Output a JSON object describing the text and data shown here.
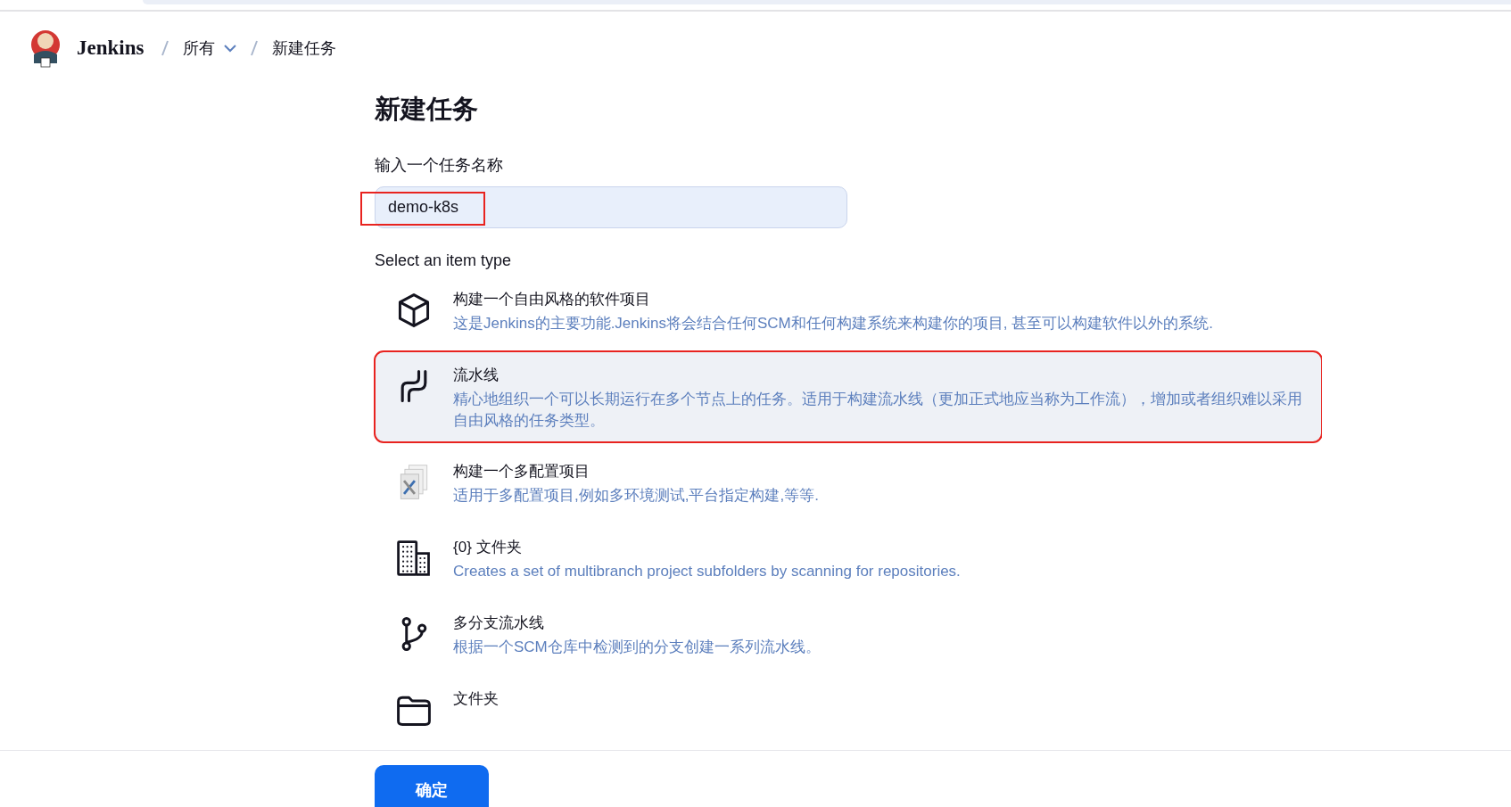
{
  "header": {
    "brand": "Jenkins",
    "breadcrumbs": [
      {
        "label": "所有",
        "dropdown": true
      },
      {
        "label": "新建任务",
        "dropdown": false
      }
    ]
  },
  "title": "新建任务",
  "name_field": {
    "label": "输入一个任务名称",
    "value": "demo-k8s",
    "annotated": true
  },
  "item_type_label": "Select an item type",
  "item_types": [
    {
      "kind": "freestyle",
      "title": "构建一个自由风格的软件项目",
      "description": "这是Jenkins的主要功能.Jenkins将会结合任何SCM和任何构建系统来构建你的项目, 甚至可以构建软件以外的系统.",
      "selected": false,
      "annotated": false
    },
    {
      "kind": "pipeline",
      "title": "流水线",
      "description": "精心地组织一个可以长期运行在多个节点上的任务。适用于构建流水线（更加正式地应当称为工作流），增加或者组织难以采用自由风格的任务类型。",
      "selected": true,
      "annotated": true
    },
    {
      "kind": "matrix",
      "title": "构建一个多配置项目",
      "description": "适用于多配置项目,例如多环境测试,平台指定构建,等等.",
      "selected": false,
      "annotated": false
    },
    {
      "kind": "organization",
      "title": "{0} 文件夹",
      "description": "Creates a set of multibranch project subfolders by scanning for repositories.",
      "selected": false,
      "annotated": false
    },
    {
      "kind": "multibranch",
      "title": "多分支流水线",
      "description": "根据一个SCM仓库中检测到的分支创建一系列流水线。",
      "selected": false,
      "annotated": false
    },
    {
      "kind": "folder",
      "title": "文件夹",
      "selected": false,
      "annotated": false
    }
  ],
  "ok_button": "确定"
}
